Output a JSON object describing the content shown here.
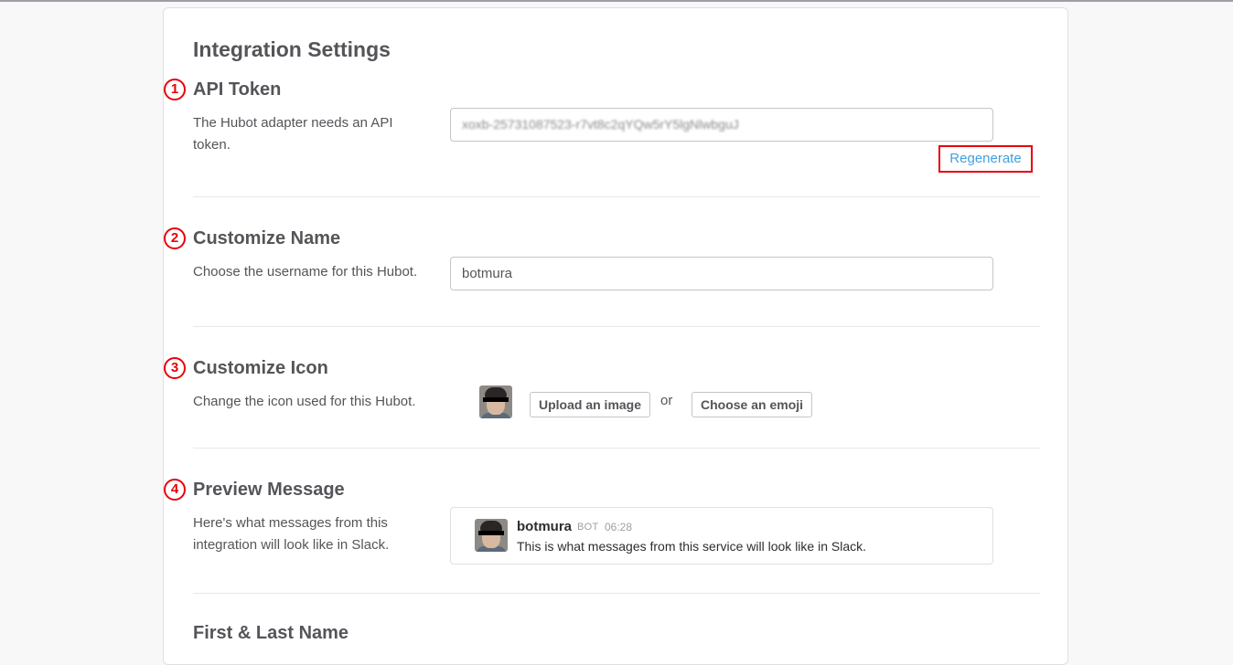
{
  "page": {
    "title": "Integration Settings"
  },
  "sections": {
    "api_token": {
      "badge": "1",
      "title": "API Token",
      "description": "The Hubot adapter needs an API token.",
      "value": "xoxb-25731087523-r7vt8c2qYQw5rY5lgNlwbguJ",
      "regenerate_label": "Regenerate"
    },
    "customize_name": {
      "badge": "2",
      "title": "Customize Name",
      "description": "Choose the username for this Hubot.",
      "value": "botmura"
    },
    "customize_icon": {
      "badge": "3",
      "title": "Customize Icon",
      "description": "Change the icon used for this Hubot.",
      "upload_label": "Upload an image",
      "or_label": "or",
      "emoji_label": "Choose an emoji"
    },
    "preview_message": {
      "badge": "4",
      "title": "Preview Message",
      "description": "Here's what messages from this integration will look like in Slack.",
      "author": "botmura",
      "bot_tag": "BOT",
      "time": "06:28",
      "text": "This is what messages from this service will look like in Slack."
    },
    "first_last_name": {
      "title": "First & Last Name"
    }
  },
  "colors": {
    "accent_link": "#439fe0",
    "annotation_red": "#e8000b",
    "text": "#555459"
  }
}
